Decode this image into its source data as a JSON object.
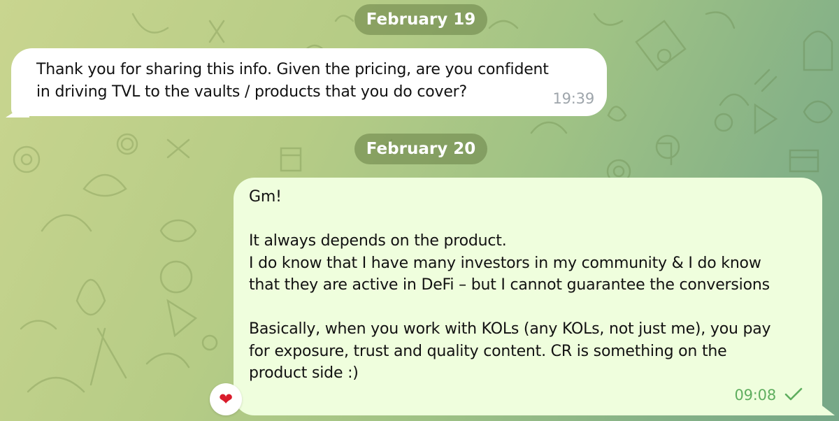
{
  "theme": {
    "bubble_in_color": "#ffffff",
    "bubble_out_color": "#effedd",
    "date_pill_color": "#7d9656",
    "time_out_color": "#5fae5f",
    "reaction_color": "#d91c2c"
  },
  "messages": [
    {
      "date": "February 19",
      "direction": "incoming",
      "lines": [
        "Thank you for sharing this info. Given the pricing, are you confident",
        "in driving TVL to the vaults / products that you do cover?"
      ],
      "time": "19:39"
    },
    {
      "date": "February 20",
      "direction": "outgoing",
      "lines": [
        "Gm!",
        "",
        "It always depends on the product.",
        "I do know that I have many investors in my community & I do know",
        "that they are active in DeFi – but I cannot guarantee the conversions",
        "",
        "Basically, when you work with KOLs (any KOLs, not just me), you pay",
        "for exposure, trust and quality content. CR is something on the",
        "product side :)"
      ],
      "time": "09:08",
      "status_icon": "single-check-icon",
      "reaction": {
        "emoji": "❤",
        "icon": "heart-icon"
      }
    }
  ]
}
